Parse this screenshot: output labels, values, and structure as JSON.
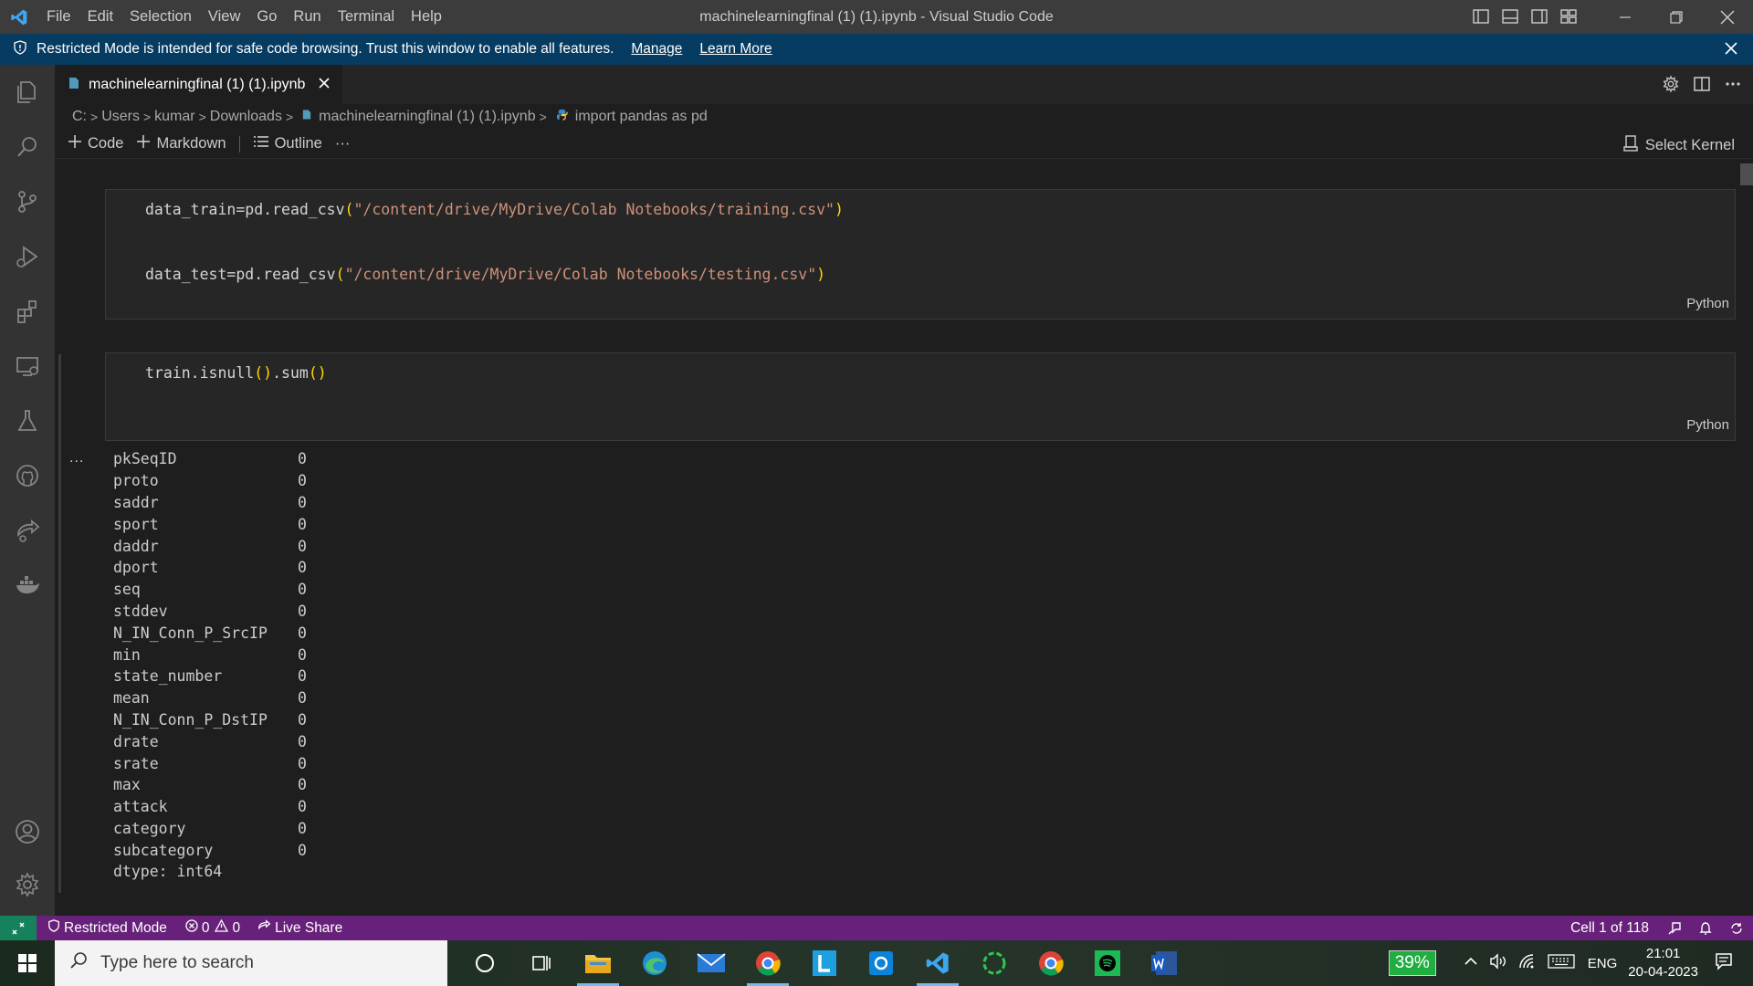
{
  "window": {
    "title": "machinelearningfinal (1) (1).ipynb - Visual Studio Code",
    "menu": [
      "File",
      "Edit",
      "Selection",
      "View",
      "Go",
      "Run",
      "Terminal",
      "Help"
    ]
  },
  "banner": {
    "message": "Restricted Mode is intended for safe code browsing. Trust this window to enable all features.",
    "manage": "Manage",
    "learn_more": "Learn More"
  },
  "tab": {
    "filename": "machinelearningfinal (1) (1).ipynb"
  },
  "breadcrumb": [
    "C:",
    "Users",
    "kumar",
    "Downloads",
    "machinelearningfinal (1) (1).ipynb",
    "import pandas as pd"
  ],
  "toolbar": {
    "code": "Code",
    "markdown": "Markdown",
    "outline": "Outline",
    "more": "···",
    "kernel": "Select Kernel"
  },
  "cells": [
    {
      "lines": [
        {
          "prefix": "data_train=pd.read_csv",
          "open": "(",
          "string": "\"/content/drive/MyDrive/Colab Notebooks/training.csv\"",
          "close": ")"
        },
        {
          "prefix": "data_test=pd.read_csv",
          "open": "(",
          "string": "\"/content/drive/MyDrive/Colab Notebooks/testing.csv\"",
          "close": ")"
        }
      ],
      "language": "Python"
    },
    {
      "line": {
        "a": "train.isnull",
        "p1": "()",
        "b": ".sum",
        "p2": "()"
      },
      "language": "Python"
    }
  ],
  "output": {
    "ellipsis": "...",
    "rows": [
      [
        "pkSeqID",
        "0"
      ],
      [
        "proto",
        "0"
      ],
      [
        "saddr",
        "0"
      ],
      [
        "sport",
        "0"
      ],
      [
        "daddr",
        "0"
      ],
      [
        "dport",
        "0"
      ],
      [
        "seq",
        "0"
      ],
      [
        "stddev",
        "0"
      ],
      [
        "N_IN_Conn_P_SrcIP",
        "0"
      ],
      [
        "min",
        "0"
      ],
      [
        "state_number",
        "0"
      ],
      [
        "mean",
        "0"
      ],
      [
        "N_IN_Conn_P_DstIP",
        "0"
      ],
      [
        "drate",
        "0"
      ],
      [
        "srate",
        "0"
      ],
      [
        "max",
        "0"
      ],
      [
        "attack",
        "0"
      ],
      [
        "category",
        "0"
      ],
      [
        "subcategory",
        "0"
      ]
    ],
    "dtype": "dtype: int64"
  },
  "statusbar": {
    "restricted": "Restricted Mode",
    "errors": "0",
    "warnings": "0",
    "live_share": "Live Share",
    "cell": "Cell 1 of 118"
  },
  "taskbar": {
    "search_placeholder": "Type here to search",
    "battery": "39%",
    "language": "ENG",
    "time": "21:01",
    "date": "20-04-2023"
  },
  "colors": {
    "status_bar": "#68217a",
    "banner": "#063b62",
    "string": "#ce9178",
    "bracket": "#ffd700"
  }
}
